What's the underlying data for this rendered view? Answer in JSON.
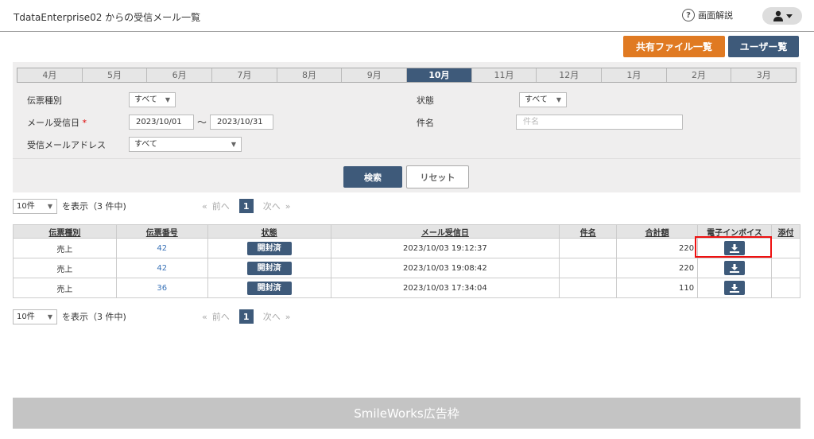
{
  "header": {
    "title": "TdataEnterprise02 からの受信メール一覧",
    "help_label": "画面解説",
    "help_icon_glyph": "?"
  },
  "actions": {
    "shared_files_label": "共有ファイル一覧",
    "users_label": "ユーザー覧"
  },
  "months": [
    "4月",
    "5月",
    "6月",
    "7月",
    "8月",
    "9月",
    "10月",
    "11月",
    "12月",
    "1月",
    "2月",
    "3月"
  ],
  "active_month": "10月",
  "filters": {
    "slip_type_label": "伝票種別",
    "slip_type_value": "すべて",
    "status_label": "状態",
    "status_value": "すべて",
    "received_date_label": "メール受信日",
    "required_mark": "*",
    "date_from": "2023/10/01",
    "date_sep": "～",
    "date_to": "2023/10/31",
    "subject_label": "件名",
    "subject_placeholder": "件名",
    "address_label": "受信メールアドレス",
    "address_value": "すべて",
    "search_label": "検索",
    "reset_label": "リセット"
  },
  "pager": {
    "per_page": "10件",
    "count_text": "を表示（3 件中)",
    "first": "«",
    "prev": "前へ",
    "page": "1",
    "next": "次へ",
    "last": "»"
  },
  "table": {
    "headers": [
      "伝票種別",
      "伝票番号",
      "状態",
      "メール受信日",
      "件名",
      "合計額",
      "電子インボイス",
      "添付"
    ],
    "rows": [
      {
        "type": "売上",
        "number": "42",
        "status": "開封済",
        "received": "2023/10/03 19:12:37",
        "subject": "",
        "total": "220"
      },
      {
        "type": "売上",
        "number": "42",
        "status": "開封済",
        "received": "2023/10/03 19:08:42",
        "subject": "",
        "total": "220"
      },
      {
        "type": "売上",
        "number": "36",
        "status": "開封済",
        "received": "2023/10/03 17:34:04",
        "subject": "",
        "total": "110"
      }
    ]
  },
  "ad_label": "SmileWorks広告枠",
  "colors": {
    "accent_navy": "#3e5a7a",
    "accent_orange": "#e07a22",
    "highlight_red": "#e11111",
    "link_blue": "#3a73b8"
  }
}
